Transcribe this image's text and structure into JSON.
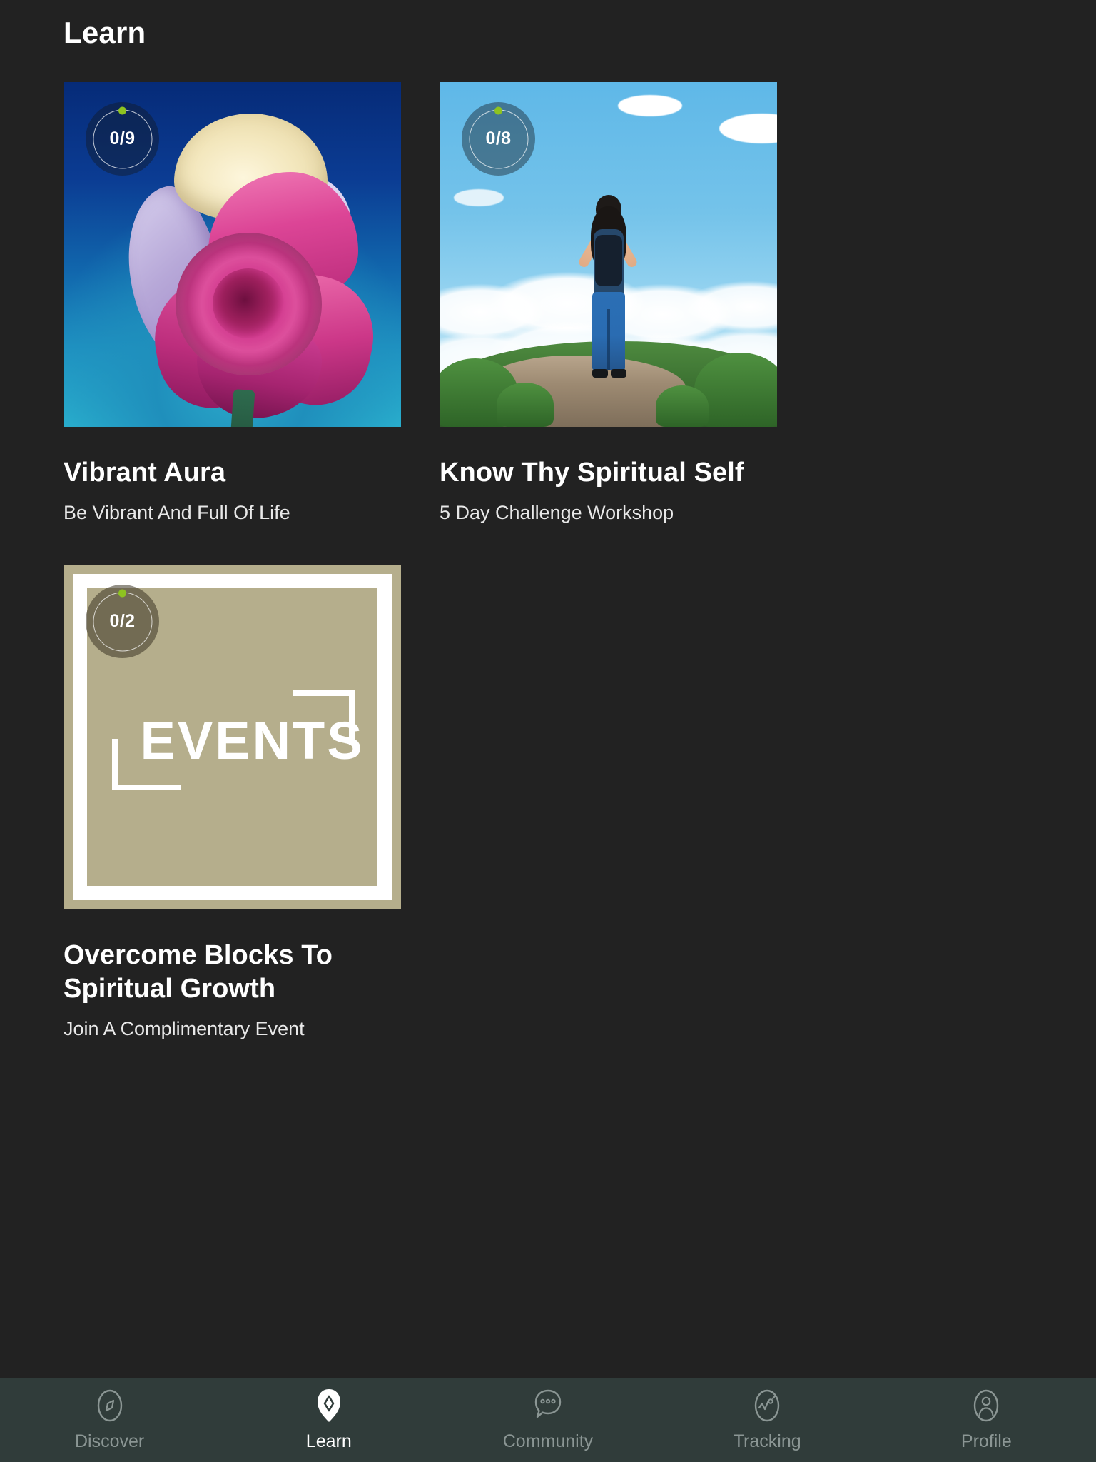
{
  "header": {
    "title": "Learn"
  },
  "cards": [
    {
      "badge": "0/9",
      "title": "Vibrant Aura",
      "subtitle": "Be Vibrant And Full Of Life",
      "thumbnail": "rose-image",
      "progress_dot_color": "#8ec320"
    },
    {
      "badge": "0/8",
      "title": "Know Thy Spiritual Self",
      "subtitle": "5 Day Challenge Workshop",
      "thumbnail": "hiker-on-mountain-image",
      "progress_dot_color": "#8ec320"
    },
    {
      "badge": "0/2",
      "title": "Overcome Blocks To Spiritual Growth",
      "subtitle": "Join A Complimentary Event",
      "thumbnail": "events-logo-image",
      "logo_word": "EVENTS",
      "progress_dot_color": "#8ec320"
    }
  ],
  "bottom_nav": {
    "items": [
      {
        "label": "Discover",
        "icon": "compass-icon",
        "active": false
      },
      {
        "label": "Learn",
        "icon": "leaf-pin-icon",
        "active": true
      },
      {
        "label": "Community",
        "icon": "chat-bubble-icon",
        "active": false
      },
      {
        "label": "Tracking",
        "icon": "pulse-icon",
        "active": false
      },
      {
        "label": "Profile",
        "icon": "person-icon",
        "active": false
      }
    ]
  },
  "colors": {
    "background": "#222222",
    "navbar_background": "#303c3a",
    "accent_green": "#8ec320",
    "text_primary": "#ffffff",
    "text_muted": "#8b9694",
    "events_tan": "#b5ae8c"
  }
}
